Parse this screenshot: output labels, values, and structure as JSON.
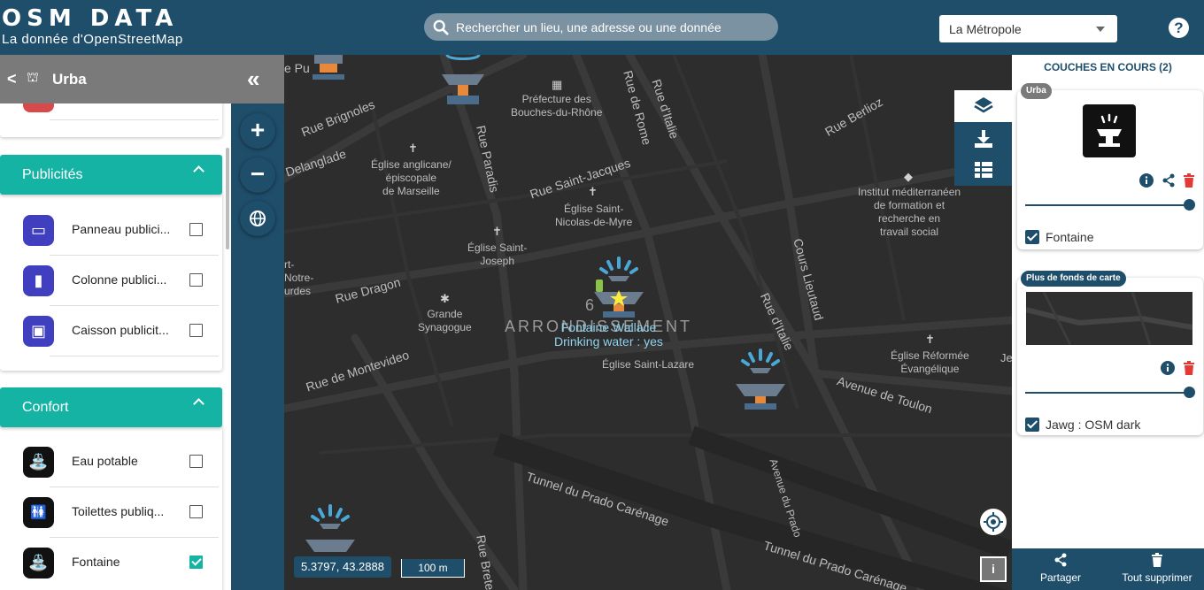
{
  "header": {
    "logo_title": "OSM DATA",
    "logo_subtitle": "La donnée d'OpenStreetMap",
    "search_placeholder": "Rechercher un lieu, une adresse ou une donnée",
    "territory": "La Métropole",
    "help_label": "?"
  },
  "left_panel": {
    "back_label": "<",
    "title": "Urba",
    "collapse_label": "«",
    "groups": [
      {
        "title": "Publicités",
        "items": [
          {
            "label": "Panneau publici...",
            "checked": false,
            "icon": "billboard-icon",
            "color": "#3f3fbf"
          },
          {
            "label": "Colonne publici...",
            "checked": false,
            "icon": "column-icon",
            "color": "#3f3fbf"
          },
          {
            "label": "Caisson publicit...",
            "checked": false,
            "icon": "lightbox-icon",
            "color": "#3f3fbf"
          }
        ]
      },
      {
        "title": "Confort",
        "items": [
          {
            "label": "Eau potable",
            "checked": false,
            "icon": "drinking-water-icon",
            "color": "#111111"
          },
          {
            "label": "Toilettes publiq...",
            "checked": false,
            "icon": "toilets-icon",
            "color": "#111111"
          },
          {
            "label": "Fontaine",
            "checked": true,
            "icon": "fountain-icon",
            "color": "#111111"
          }
        ]
      }
    ]
  },
  "map": {
    "streets": [
      "Rue Brignoles",
      "Delanglade",
      "Rue Paradis",
      "Rue de Rome",
      "Rue d'Italie",
      "Rue Berlioz",
      "Rue Saint-Jacques",
      "Rue Dragon",
      "Cours Lieutaud",
      "Rue d'Italie",
      "Rue de Montevideo",
      "Avenue de Toulon",
      "Tunnel du Prado Carénage",
      "Avenue du Prado",
      "Rue Breteuil",
      "Tunnel du Prado Carénage"
    ],
    "pois": [
      "Préfecture des\nBouches-du-Rhône",
      "Église anglicane/\népiscopale\nde Marseille",
      "Église Saint-\nNicolas-de-Myre",
      "Église Saint-\nJoseph",
      "Institut méditerranéen\nde formation et\nrecherche en\ntravail social",
      "Grande\nSynagogue",
      "Église Réformée\nÉvangélique",
      "Église Saint-Lazare"
    ],
    "left_edge_labels": [
      "e Pu",
      "rt-\nNotre-\nurdes"
    ],
    "arrondissement": "6 ARRONDISSEMENT",
    "arrondissement_left": "6",
    "arrondissement_right": "ARRONDISSEMENT",
    "popup_line1": "Fontaine Wallace",
    "popup_line2": "Drinking water : yes",
    "coords": "5.3797, 43.2888",
    "scale": "100 m",
    "info_label": "i",
    "zoom_in": "+",
    "zoom_out": "−",
    "right_edge_label": "Je"
  },
  "right_panel": {
    "title": "COUCHES EN COURS (2)",
    "layers": [
      {
        "tag": "Urba",
        "label": "Fontaine",
        "checked": true,
        "opacity": 1.0
      },
      {
        "tag": "Plus de fonds de carte",
        "label": "Jawg : OSM dark",
        "checked": true,
        "opacity": 1.0
      }
    ],
    "share_label": "Partager",
    "delete_all_label": "Tout supprimer"
  },
  "colors": {
    "brand": "#1f4e6b",
    "teal": "#14b3a3",
    "danger": "#e53935",
    "fountain_blue": "#4aa8d8"
  }
}
